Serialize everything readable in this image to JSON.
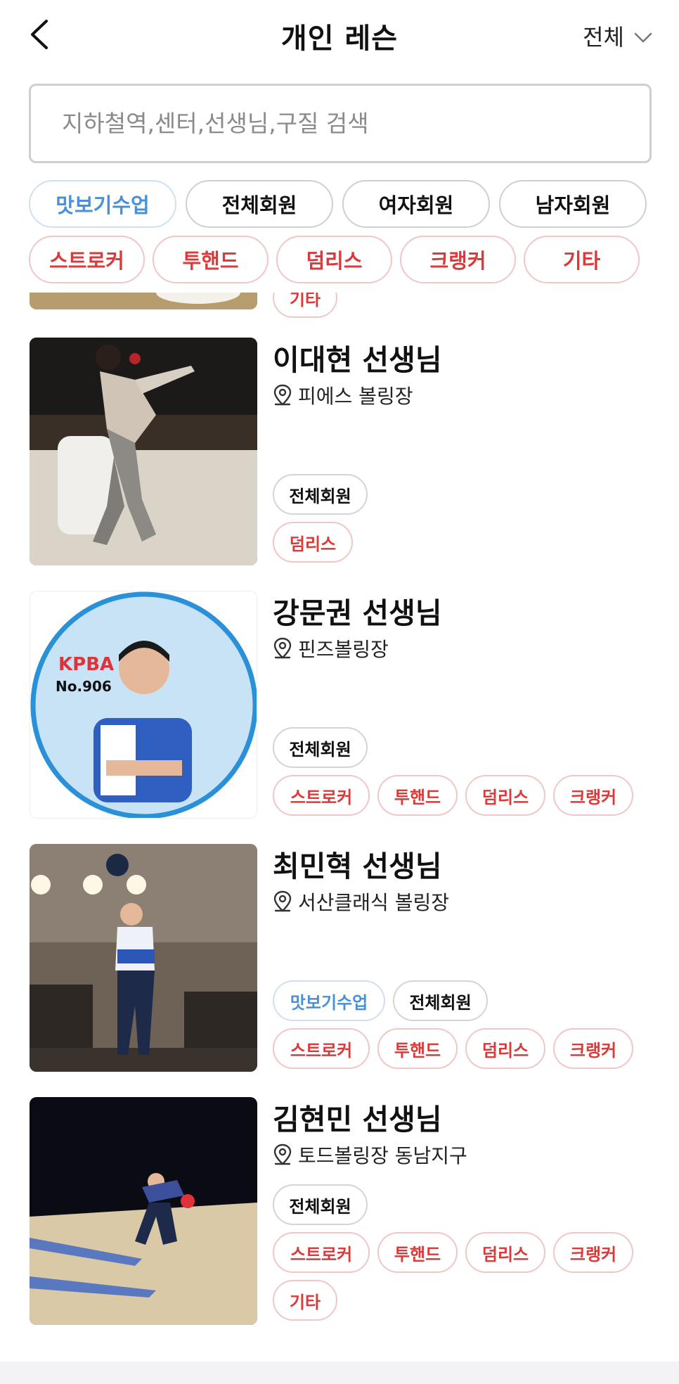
{
  "header": {
    "title": "개인 레슨",
    "filter_label": "전체"
  },
  "search": {
    "placeholder": "지하철역,센터,선생님,구질 검색",
    "value": ""
  },
  "filter_chips_row1": [
    {
      "label": "맛보기수업",
      "style": "blue"
    },
    {
      "label": "전체회원",
      "style": "black"
    },
    {
      "label": "여자회원",
      "style": "black"
    },
    {
      "label": "남자회원",
      "style": "black"
    }
  ],
  "filter_chips_row2": [
    "스트로커",
    "투핸드",
    "덤리스",
    "크랭커",
    "기타"
  ],
  "colors": {
    "blue": "#4a90d9",
    "red": "#d93b3b",
    "chip_red_border": "#f1c6c6"
  },
  "teachers": [
    {
      "name": "이대현 선생님",
      "location": "피에스 볼링장",
      "tags_top": [
        "전체회원"
      ],
      "tags_bottom": [
        "덤리스"
      ],
      "photo_icon": "bowler-photo"
    },
    {
      "name": "강문권 선생님",
      "location": "핀즈볼링장",
      "tags_top": [
        "전체회원"
      ],
      "tags_bottom": [
        "스트로커",
        "투핸드",
        "덤리스",
        "크랭커"
      ],
      "photo_text": "KPBA",
      "photo_text2": "No.906"
    },
    {
      "name": "최민혁 선생님",
      "location": "서산클래식 볼링장",
      "tags_top": [
        "맛보기수업",
        "전체회원"
      ],
      "tags_bottom": [
        "스트로커",
        "투핸드",
        "덤리스",
        "크랭커"
      ],
      "photo_icon": "bowler-photo"
    },
    {
      "name": "김현민 선생님",
      "location": "토드볼링장 동남지구",
      "tags_top": [
        "전체회원"
      ],
      "tags_bottom": [
        "스트로커",
        "투핸드",
        "덤리스",
        "크랭커"
      ],
      "tags_extra": [
        "기타"
      ],
      "photo_icon": "bowler-photo"
    }
  ],
  "partial_card": {
    "tag": "기타"
  }
}
